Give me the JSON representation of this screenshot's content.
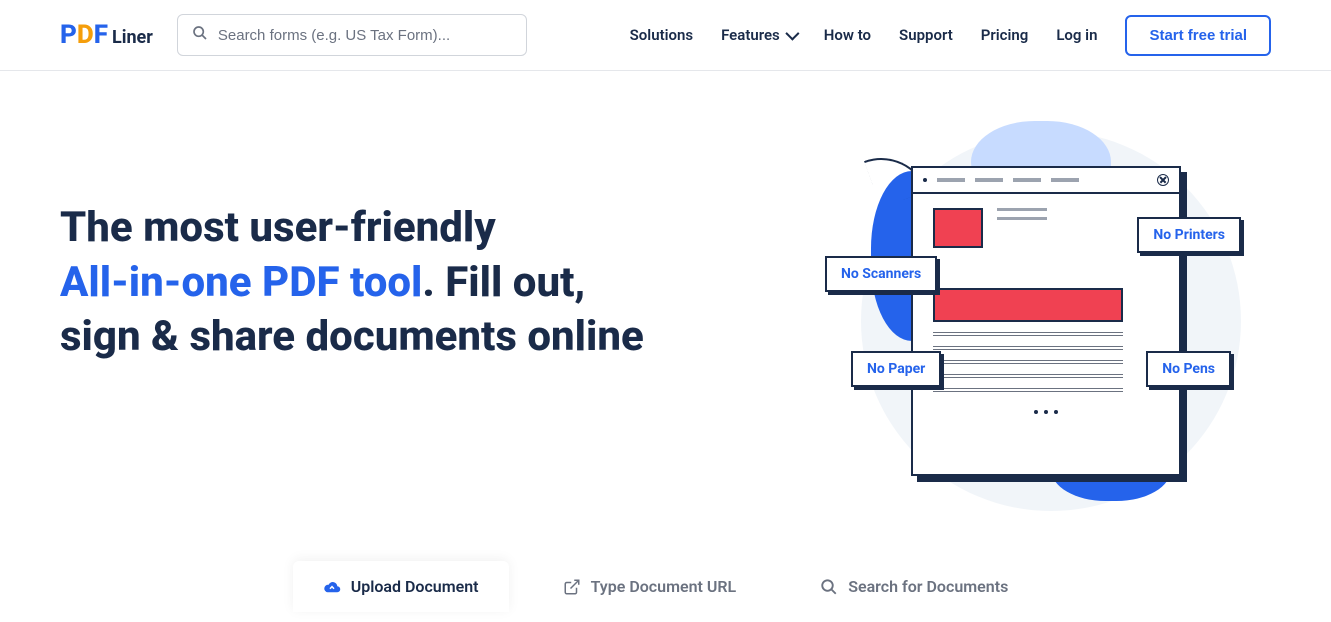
{
  "logo": {
    "liner": "Liner"
  },
  "search": {
    "placeholder": "Search forms (e.g. US Tax Form)..."
  },
  "nav": {
    "solutions": "Solutions",
    "features": "Features",
    "howto": "How to",
    "support": "Support",
    "pricing": "Pricing",
    "login": "Log in"
  },
  "trial_button": "Start free trial",
  "hero": {
    "line1": "The most user-friendly",
    "highlight": "All-in-one PDF tool",
    "line2_after": ". Fill out,",
    "line3": "sign & share documents online"
  },
  "badges": {
    "printers": "No Printers",
    "scanners": "No Scanners",
    "paper": "No Paper",
    "pens": "No Pens"
  },
  "tabs": {
    "upload": "Upload Document",
    "url": "Type Document URL",
    "search": "Search for Documents"
  }
}
